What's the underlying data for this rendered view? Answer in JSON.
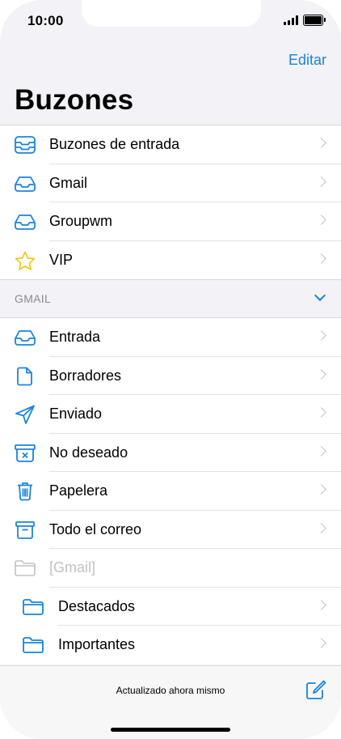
{
  "status_bar": {
    "time": "10:00"
  },
  "nav": {
    "edit_label": "Editar",
    "title": "Buzones"
  },
  "top_mailboxes": [
    {
      "label": "Buzones de entrada",
      "icon": "all-inboxes-icon"
    },
    {
      "label": "Gmail",
      "icon": "inbox-tray-icon"
    },
    {
      "label": "Groupwm",
      "icon": "inbox-tray-icon"
    },
    {
      "label": "VIP",
      "icon": "star-icon"
    }
  ],
  "gmail_section": {
    "header": "GMAIL",
    "items": [
      {
        "label": "Entrada",
        "icon": "inbox-tray-icon"
      },
      {
        "label": "Borradores",
        "icon": "document-icon"
      },
      {
        "label": "Enviado",
        "icon": "paper-plane-icon"
      },
      {
        "label": "No deseado",
        "icon": "junk-bin-icon"
      },
      {
        "label": "Papelera",
        "icon": "trash-icon"
      },
      {
        "label": "Todo el correo",
        "icon": "archive-box-icon"
      },
      {
        "label": "[Gmail]",
        "icon": "folder-icon",
        "disabled": true
      },
      {
        "label": "Destacados",
        "icon": "folder-icon"
      },
      {
        "label": "Importantes",
        "icon": "folder-icon"
      }
    ]
  },
  "toolbar": {
    "status": "Actualizado ahora mismo"
  },
  "colors": {
    "accent": "#1a84de",
    "vip_star": "#f5c400",
    "disabled": "#c2c2c6",
    "background": "#f2f2f7"
  }
}
